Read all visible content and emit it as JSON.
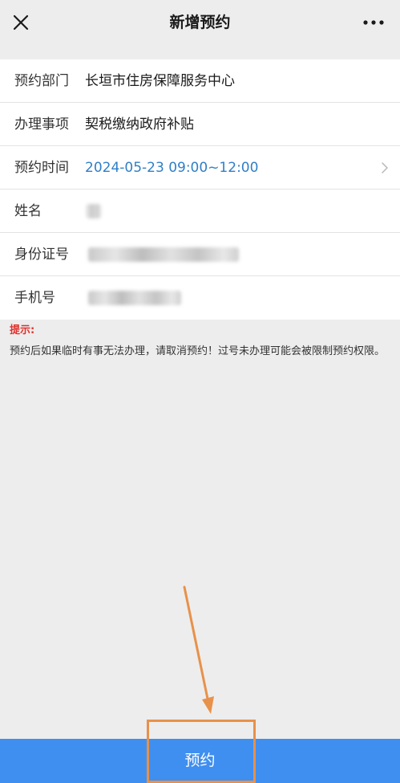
{
  "header": {
    "title": "新增预约",
    "close_icon": "close-icon",
    "more_icon": "more-horizontal-icon"
  },
  "form": {
    "rows": [
      {
        "label": "预约部门",
        "value": "长垣市住房保障服务中心"
      },
      {
        "label": "办理事项",
        "value": "契税缴纳政府补贴"
      },
      {
        "label": "预约时间",
        "value": "2024-05-23 09:00~12:00",
        "has_chevron": true
      },
      {
        "label": "姓名",
        "value": "",
        "redacted": true
      },
      {
        "label": "身份证号",
        "value": "",
        "redacted": true
      },
      {
        "label": "手机号",
        "value": "",
        "redacted": true
      }
    ]
  },
  "notice": {
    "title": "提示:",
    "text": "预约后如果临时有事无法办理，请取消预约！过号未办理可能会被限制预约权限。"
  },
  "submit": {
    "label": "预约"
  },
  "colors": {
    "accent": "#3f8ff0",
    "link": "#2f7fc8",
    "notice_title": "#e0312b",
    "annotation": "#e8914a"
  }
}
